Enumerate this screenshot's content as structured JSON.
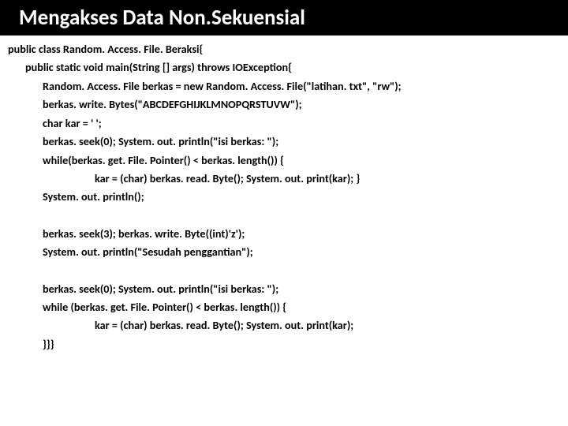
{
  "title": "Mengakses Data Non.Sekuensial",
  "code": {
    "l0": "public class Random. Access. File. Beraksi{",
    "l1": "public static void main(String [] args) throws IOException{",
    "l2": "Random. Access. File berkas = new Random. Access. File(\"latihan. txt\", \"rw\");",
    "l3": "berkas. write. Bytes(\"ABCDEFGHIJKLMNOPQRSTUVW\");",
    "l4": "char kar = ' ';",
    "l5": "berkas. seek(0); System. out. println(\"isi berkas: \");",
    "l6": "while(berkas. get. File. Pointer() < berkas. length()) {",
    "l7": "kar = (char) berkas. read. Byte(); System. out. print(kar); }",
    "l8": "System. out. println();",
    "l9": "berkas. seek(3); berkas. write. Byte((int)'z');",
    "l10": "System. out. println(\"Sesudah penggantian\");",
    "l11": "berkas. seek(0); System. out. println(\"isi berkas: \");",
    "l12": "while (berkas. get. File. Pointer() < berkas. length()) {",
    "l13": "kar = (char) berkas. read. Byte(); System. out. print(kar);",
    "l14": "}}}"
  }
}
